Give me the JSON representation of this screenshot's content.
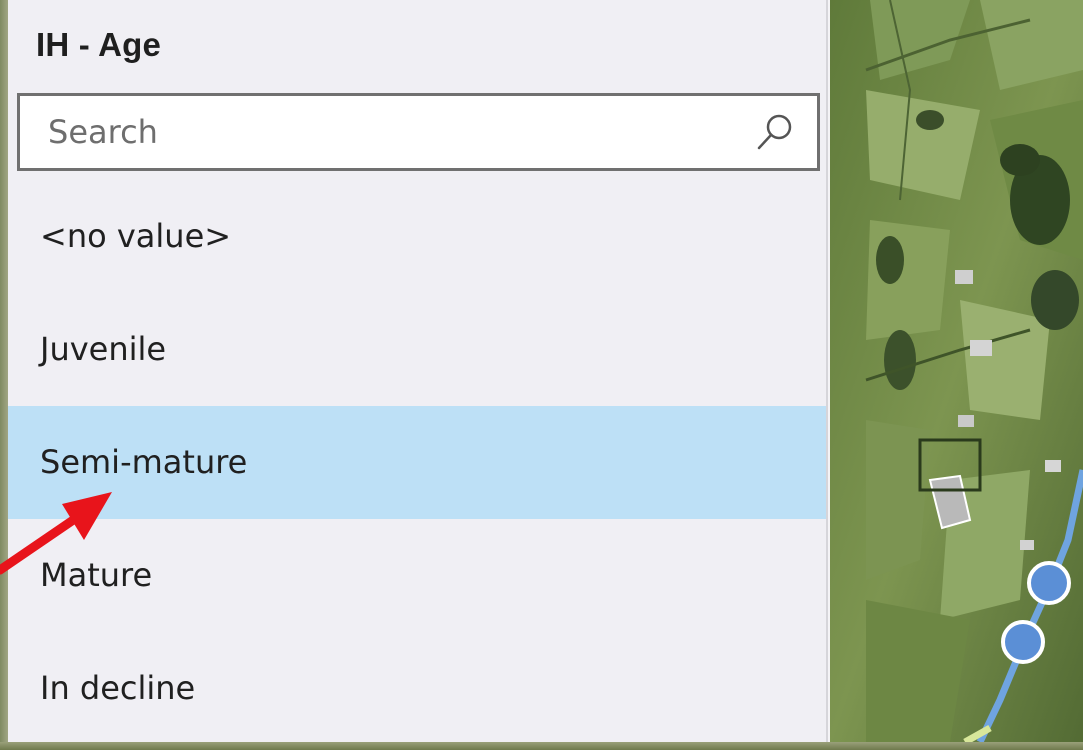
{
  "panel": {
    "title": "IH - Age",
    "search": {
      "placeholder": "Search",
      "value": ""
    },
    "items": [
      {
        "label": "<no value>",
        "selected": false
      },
      {
        "label": "Juvenile",
        "selected": false
      },
      {
        "label": "Semi-mature",
        "selected": true
      },
      {
        "label": "Mature",
        "selected": false
      },
      {
        "label": "In decline",
        "selected": false
      }
    ]
  },
  "colors": {
    "panel_bg": "#f0eff4",
    "selection": "#bde0f6",
    "annotation": "#e8141b",
    "map_feature": "#5b8fd6"
  },
  "icons": {
    "search": "search-icon",
    "annotation": "red-arrow-icon"
  }
}
